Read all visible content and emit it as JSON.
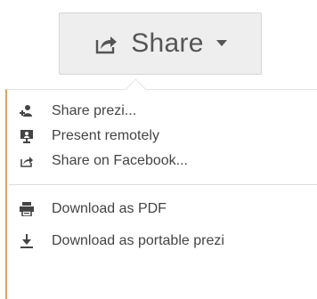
{
  "share_button": {
    "label": "Share",
    "icon": "share-arrow-icon",
    "caret_icon": "caret-down-icon"
  },
  "menu": {
    "items": [
      {
        "label": "Share prezi...",
        "icon": "share-users-icon"
      },
      {
        "label": "Present remotely",
        "icon": "present-remotely-icon"
      },
      {
        "label": "Share on Facebook...",
        "icon": "share-arrow-icon"
      },
      {
        "label": "Download as PDF",
        "icon": "printer-icon"
      },
      {
        "label": "Download as portable prezi",
        "icon": "download-icon"
      }
    ]
  },
  "colors": {
    "button_bg": "#eeeeee",
    "button_text": "#555555",
    "menu_text": "#444444",
    "menu_accent_border": "#d9a35c"
  }
}
